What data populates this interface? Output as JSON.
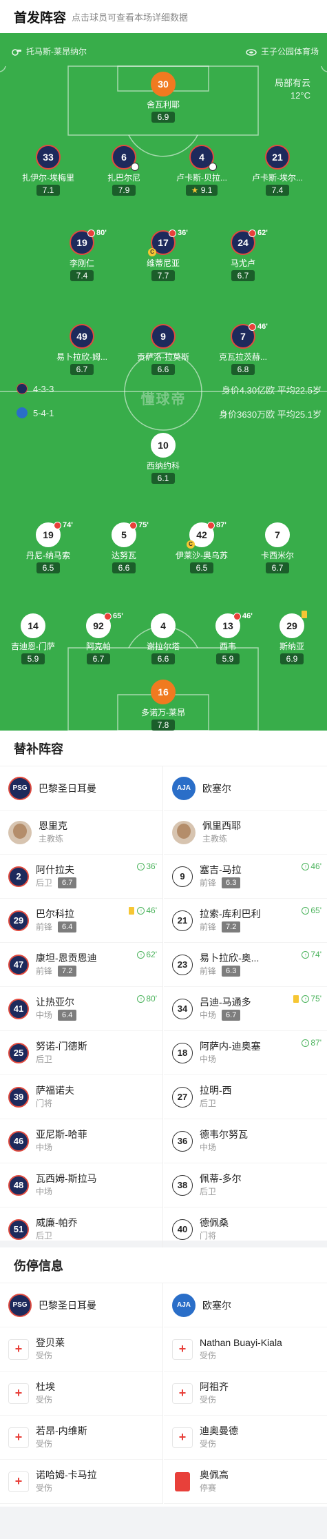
{
  "header": {
    "title": "首发阵容",
    "subtitle": "点击球员可查看本场详细数据"
  },
  "match": {
    "referee": "托马斯-莱昂纳尔",
    "stadium": "王子公园体育场",
    "weather": "局部有云",
    "temperature": "12°C",
    "watermark": "懂球帝"
  },
  "home": {
    "name": "巴黎圣日耳曼",
    "formation": "4-3-3",
    "stats": "身价4.30亿欧  平均22.5岁",
    "coach": "恩里克",
    "coach_role": "主教练",
    "color": "#1d2a5c"
  },
  "away": {
    "name": "欧塞尔",
    "formation": "5-4-1",
    "stats": "身价3630万欧  平均25.1岁",
    "coach": "佩里西耶",
    "coach_role": "主教练",
    "color": "#2a6ec8"
  },
  "lineup": {
    "home": [
      {
        "num": "30",
        "name": "舍瓦利耶",
        "rating": "6.9"
      },
      {
        "num": "33",
        "name": "扎伊尔-埃梅里",
        "rating": "7.1"
      },
      {
        "num": "6",
        "name": "扎巴尔尼",
        "rating": "7.9"
      },
      {
        "num": "4",
        "name": "卢卡斯-贝拉...",
        "rating": "9.1"
      },
      {
        "num": "21",
        "name": "卢卡斯-埃尔...",
        "rating": "7.4"
      },
      {
        "num": "19",
        "name": "李刚仁",
        "rating": "7.4",
        "sub": "80'"
      },
      {
        "num": "17",
        "name": "维蒂尼亚",
        "rating": "7.7",
        "sub": "36'"
      },
      {
        "num": "24",
        "name": "马尤卢",
        "rating": "6.7",
        "sub": "62'"
      },
      {
        "num": "49",
        "name": "易卜拉欣-姆...",
        "rating": "6.7"
      },
      {
        "num": "9",
        "name": "贡萨洛-拉莫斯",
        "rating": "6.6"
      },
      {
        "num": "7",
        "name": "克瓦拉茨赫...",
        "rating": "6.8",
        "sub": "46'"
      }
    ],
    "away": [
      {
        "num": "10",
        "name": "西纳约科",
        "rating": "6.1"
      },
      {
        "num": "19",
        "name": "丹尼-纳马索",
        "rating": "6.5",
        "sub": "74'"
      },
      {
        "num": "5",
        "name": "达努瓦",
        "rating": "6.6",
        "sub": "75'"
      },
      {
        "num": "42",
        "name": "伊莱沙-奥乌苏",
        "rating": "6.5",
        "sub": "87'"
      },
      {
        "num": "7",
        "name": "卡西米尔",
        "rating": "6.7"
      },
      {
        "num": "14",
        "name": "吉迪恩-门萨",
        "rating": "5.9"
      },
      {
        "num": "92",
        "name": "阿克帕",
        "rating": "6.7",
        "sub": "65'"
      },
      {
        "num": "4",
        "name": "谢拉尔塔",
        "rating": "6.6"
      },
      {
        "num": "13",
        "name": "西韦",
        "rating": "5.9",
        "sub": "46'"
      },
      {
        "num": "29",
        "name": "斯纳亚",
        "rating": "6.9"
      },
      {
        "num": "16",
        "name": "多诺万-莱昂",
        "rating": "7.8"
      }
    ]
  },
  "subs": {
    "title": "替补阵容",
    "home": [
      {
        "num": "2",
        "name": "阿什拉夫",
        "pos": "后卫",
        "rating": "6.7",
        "in": "36'"
      },
      {
        "num": "29",
        "name": "巴尔科拉",
        "pos": "前锋",
        "rating": "6.4",
        "in": "46'",
        "card": "yellow"
      },
      {
        "num": "47",
        "name": "康坦-恩贡恩迪",
        "pos": "前锋",
        "rating": "7.2",
        "in": "62'"
      },
      {
        "num": "41",
        "name": "让热亚尔",
        "pos": "中场",
        "rating": "6.4",
        "in": "80'"
      },
      {
        "num": "25",
        "name": "努诺-门德斯",
        "pos": "后卫"
      },
      {
        "num": "39",
        "name": "萨福诺夫",
        "pos": "门将"
      },
      {
        "num": "46",
        "name": "亚尼斯-哈菲",
        "pos": "中场"
      },
      {
        "num": "48",
        "name": "瓦西姆-斯拉马",
        "pos": "中场"
      },
      {
        "num": "51",
        "name": "威廉-帕乔",
        "pos": "后卫"
      }
    ],
    "away": [
      {
        "num": "9",
        "name": "塞吉-马拉",
        "pos": "前锋",
        "rating": "6.3",
        "in": "46'"
      },
      {
        "num": "21",
        "name": "拉索-库利巴利",
        "pos": "前锋",
        "rating": "7.2",
        "in": "65'"
      },
      {
        "num": "23",
        "name": "易卜拉欣-奥...",
        "pos": "前锋",
        "rating": "6.3",
        "in": "74'"
      },
      {
        "num": "34",
        "name": "吕迪-马通多",
        "pos": "中场",
        "rating": "6.7",
        "in": "75'",
        "card": "yellow"
      },
      {
        "num": "18",
        "name": "阿萨内-迪奥塞",
        "pos": "中场",
        "in": "87'"
      },
      {
        "num": "27",
        "name": "拉明-西",
        "pos": "后卫"
      },
      {
        "num": "36",
        "name": "德韦尔努瓦",
        "pos": "中场"
      },
      {
        "num": "38",
        "name": "佩蒂-多尔",
        "pos": "后卫"
      },
      {
        "num": "40",
        "name": "德佩桑",
        "pos": "门将"
      }
    ]
  },
  "injuries": {
    "title": "伤停信息",
    "home": [
      {
        "name": "登贝莱",
        "status": "受伤",
        "type": "injury"
      },
      {
        "name": "杜埃",
        "status": "受伤",
        "type": "injury"
      },
      {
        "name": "若昂-内维斯",
        "status": "受伤",
        "type": "injury"
      },
      {
        "name": "诺哈姆-卡马拉",
        "status": "受伤",
        "type": "injury"
      }
    ],
    "away": [
      {
        "name": "Nathan Buayi-Kiala",
        "status": "受伤",
        "type": "injury"
      },
      {
        "name": "阿祖齐",
        "status": "受伤",
        "type": "injury"
      },
      {
        "name": "迪奥曼德",
        "status": "受伤",
        "type": "injury"
      },
      {
        "name": "奥佩高",
        "status": "停赛",
        "type": "suspension"
      }
    ]
  }
}
